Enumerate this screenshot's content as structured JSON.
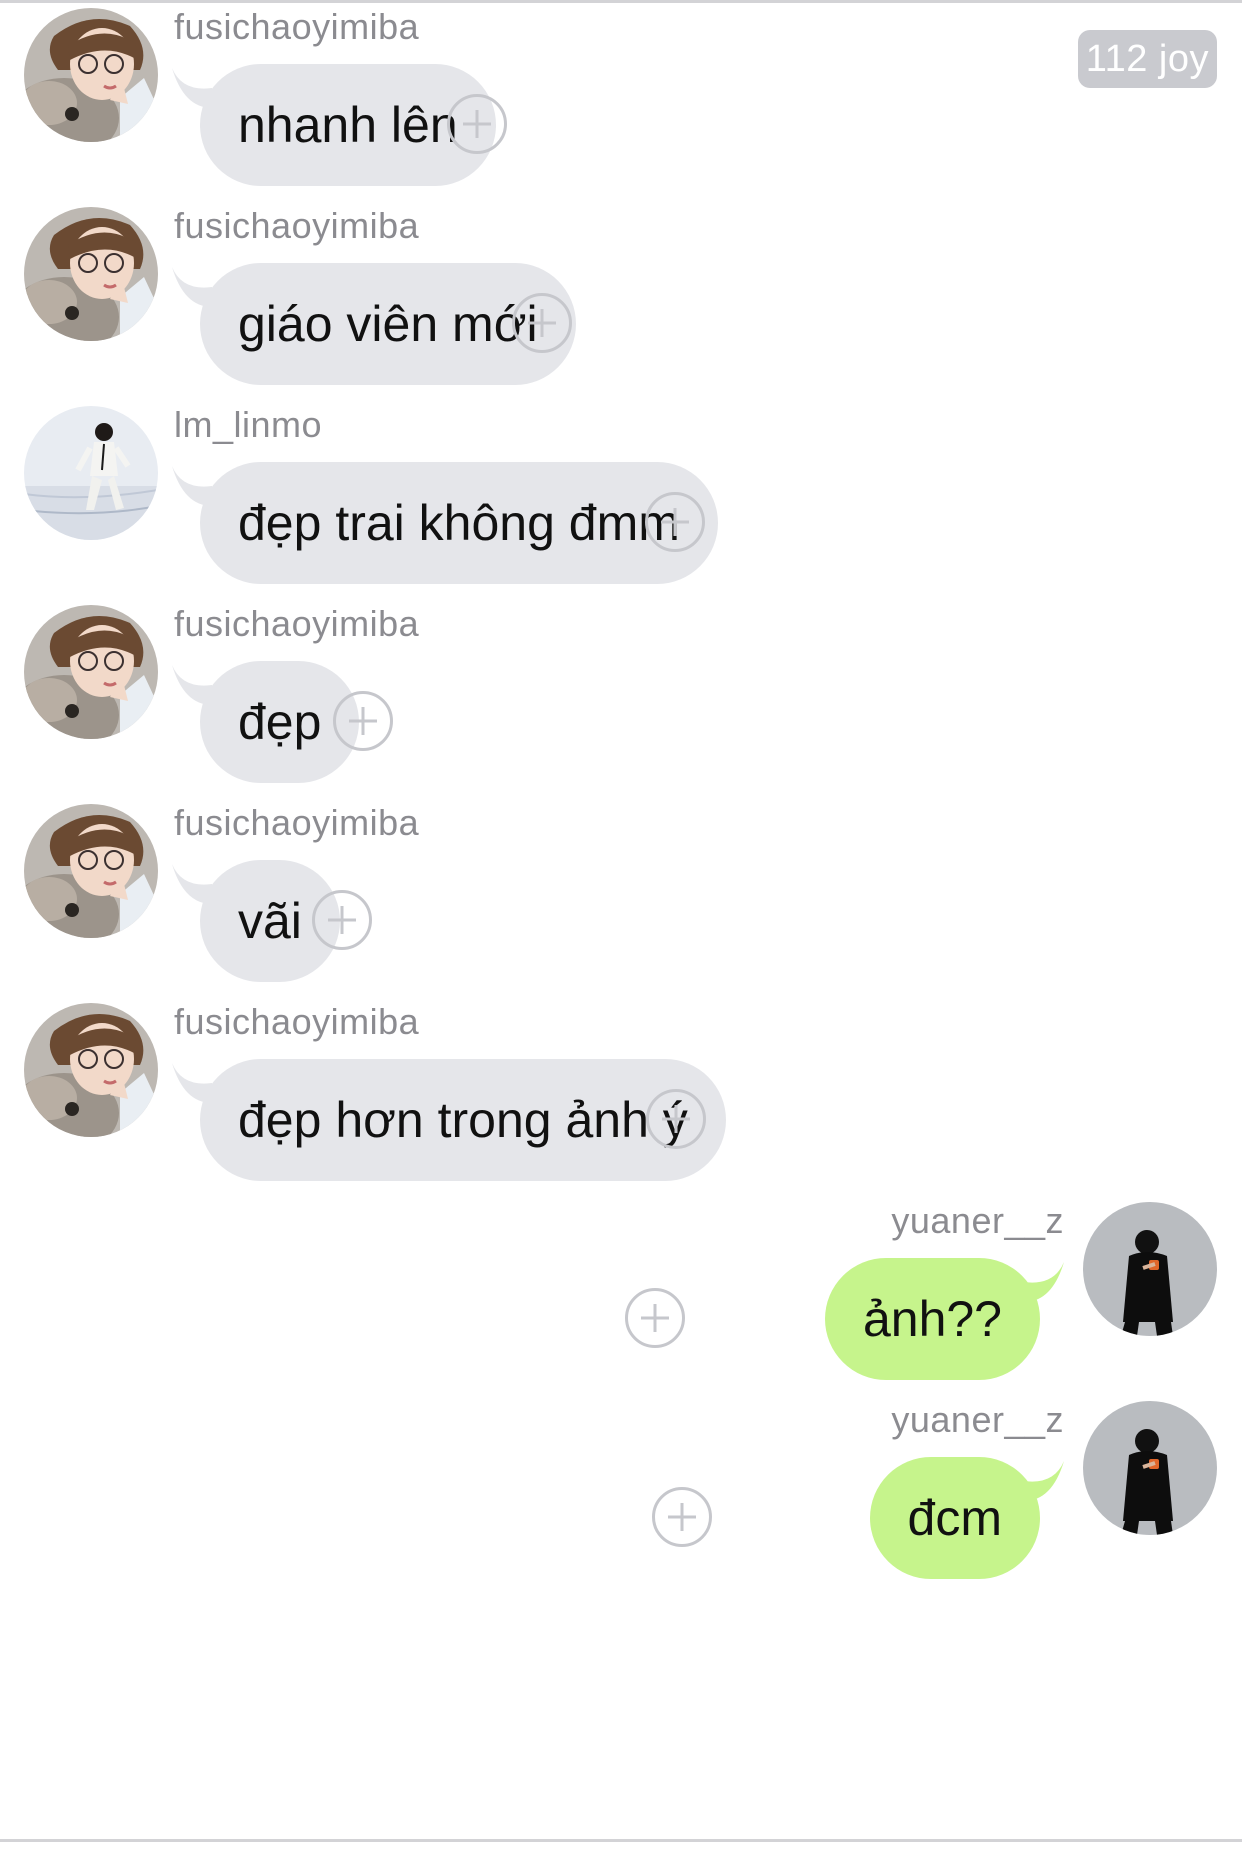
{
  "badge": {
    "text": "112 joy",
    "color": "#c9cacf"
  },
  "colors": {
    "incoming_bubble": "#e5e6ea",
    "outgoing_bubble": "#c6f48c",
    "sender_text": "#8b8b90",
    "add_button": "#c6c7cc"
  },
  "messages": [
    {
      "sender": "fusichaoyimiba",
      "text": "nhanh lên",
      "direction": "incoming",
      "avatar": "avatar-fusichaoyimiba",
      "action_icon": "add-reaction-icon"
    },
    {
      "sender": "fusichaoyimiba",
      "text": "giáo viên mới",
      "direction": "incoming",
      "avatar": "avatar-fusichaoyimiba",
      "action_icon": "add-reaction-icon"
    },
    {
      "sender": "lm_linmo",
      "text": "đẹp trai không đmm",
      "direction": "incoming",
      "avatar": "avatar-lm-linmo",
      "action_icon": "add-reaction-icon"
    },
    {
      "sender": "fusichaoyimiba",
      "text": "đẹp",
      "direction": "incoming",
      "avatar": "avatar-fusichaoyimiba",
      "action_icon": "add-reaction-icon"
    },
    {
      "sender": "fusichaoyimiba",
      "text": "vãi",
      "direction": "incoming",
      "avatar": "avatar-fusichaoyimiba",
      "action_icon": "add-reaction-icon"
    },
    {
      "sender": "fusichaoyimiba",
      "text": "đẹp hơn trong ảnh ý",
      "direction": "incoming",
      "avatar": "avatar-fusichaoyimiba",
      "action_icon": "add-reaction-icon"
    },
    {
      "sender": "yuaner__z",
      "text": "ảnh??",
      "direction": "outgoing",
      "avatar": "avatar-yuaner-z",
      "action_icon": "add-reaction-icon"
    },
    {
      "sender": "yuaner__z",
      "text": "đcm",
      "direction": "outgoing",
      "avatar": "avatar-yuaner-z",
      "action_icon": "add-reaction-icon"
    }
  ]
}
